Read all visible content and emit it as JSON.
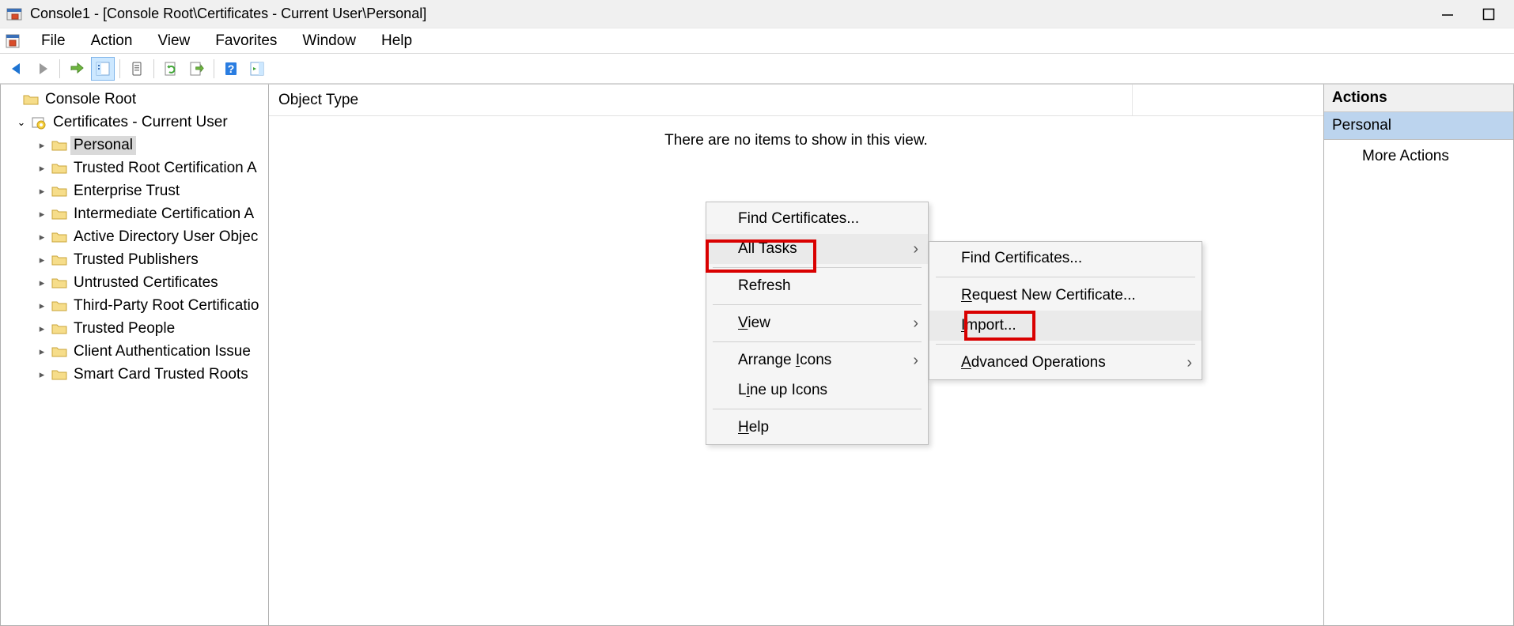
{
  "title": "Console1 - [Console Root\\Certificates - Current User\\Personal]",
  "menubar": {
    "items": [
      "File",
      "Action",
      "View",
      "Favorites",
      "Window",
      "Help"
    ]
  },
  "tree": {
    "root": {
      "label": "Console Root"
    },
    "cert_root": {
      "label": "Certificates - Current User"
    },
    "children": [
      {
        "label": "Personal",
        "selected": true
      },
      {
        "label": "Trusted Root Certification A"
      },
      {
        "label": "Enterprise Trust"
      },
      {
        "label": "Intermediate Certification A"
      },
      {
        "label": "Active Directory User Objec"
      },
      {
        "label": "Trusted Publishers"
      },
      {
        "label": "Untrusted Certificates"
      },
      {
        "label": "Third-Party Root Certificatio"
      },
      {
        "label": "Trusted People"
      },
      {
        "label": "Client Authentication Issue"
      },
      {
        "label": "Smart Card Trusted Roots"
      }
    ]
  },
  "content": {
    "column_header": "Object Type",
    "empty_message": "There are no items to show in this view."
  },
  "actions": {
    "header": "Actions",
    "section": "Personal",
    "link": "More Actions"
  },
  "context_menu": {
    "items": [
      {
        "label": "Find Certificates..."
      },
      {
        "label": "All Tasks",
        "has_sub": true,
        "highlighted": true
      },
      {
        "sep": true
      },
      {
        "label": "Refresh"
      },
      {
        "sep": true
      },
      {
        "label": "View",
        "has_sub": true,
        "u": 0
      },
      {
        "sep": true
      },
      {
        "label": "Arrange Icons",
        "has_sub": true,
        "u": 8
      },
      {
        "label": "Line up Icons",
        "u": 1
      },
      {
        "sep": true
      },
      {
        "label": "Help",
        "u": 0
      }
    ]
  },
  "submenu": {
    "items": [
      {
        "label": "Find Certificates..."
      },
      {
        "sep": true
      },
      {
        "label": "Request New Certificate...",
        "u": 0
      },
      {
        "label": "Import...",
        "u": 0,
        "highlighted": true
      },
      {
        "sep": true
      },
      {
        "label": "Advanced Operations",
        "has_sub": true,
        "u": 0
      }
    ]
  }
}
